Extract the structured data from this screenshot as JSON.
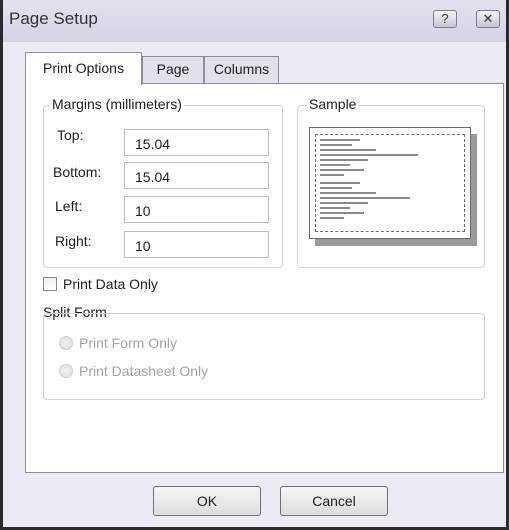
{
  "window": {
    "title": "Page Setup",
    "help_glyph": "?",
    "close_glyph": "✕"
  },
  "tabs": [
    {
      "label": "Print Options",
      "active": true
    },
    {
      "label": "Page",
      "active": false
    },
    {
      "label": "Columns",
      "active": false
    }
  ],
  "margins": {
    "group_label": "Margins (millimeters)",
    "top": {
      "label": "Top:",
      "value": "15.04"
    },
    "bottom": {
      "label": "Bottom:",
      "value": "15.04"
    },
    "left": {
      "label": "Left:",
      "value": "10"
    },
    "right": {
      "label": "Right:",
      "value": "10"
    }
  },
  "sample": {
    "group_label": "Sample"
  },
  "print_data_only": {
    "label": "Print Data Only",
    "checked": false
  },
  "split_form": {
    "group_label": "Split Form",
    "enabled": false,
    "options": [
      "Print Form Only",
      "Print Datasheet Only"
    ]
  },
  "buttons": {
    "ok": "OK",
    "cancel": "Cancel"
  },
  "colors": {
    "dialog_bg": "#eceaf3",
    "panel_bg": "#ffffff",
    "disabled_text": "#a3a3a3"
  }
}
